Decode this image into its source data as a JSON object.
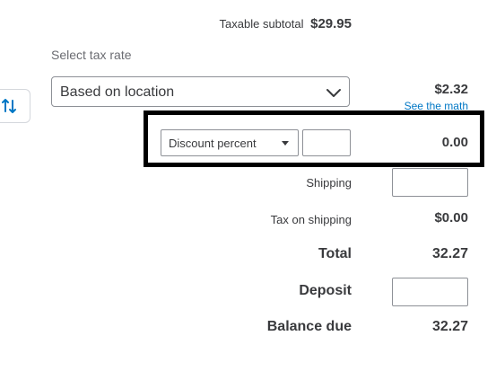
{
  "taxable_subtotal": {
    "label": "Taxable subtotal",
    "value": "$29.95"
  },
  "tax": {
    "select_label": "Select tax rate",
    "rate_value": "Based on location",
    "amount": "$2.32",
    "see_math_link": "See the math"
  },
  "discount": {
    "type_value": "Discount percent",
    "input_value": "",
    "amount": "0.00"
  },
  "shipping": {
    "label": "Shipping",
    "input_value": ""
  },
  "tax_on_shipping": {
    "label": "Tax on shipping",
    "value": "$0.00"
  },
  "total": {
    "label": "Total",
    "value": "32.27"
  },
  "deposit": {
    "label": "Deposit",
    "input_value": ""
  },
  "balance_due": {
    "label": "Balance due",
    "value": "32.27"
  },
  "colors": {
    "link": "#0077c5",
    "text": "#393a3d",
    "highlight_border": "#000000"
  },
  "icons": {
    "side_tab": "sort-arrows-icon",
    "select": "chevron-down-icon"
  }
}
